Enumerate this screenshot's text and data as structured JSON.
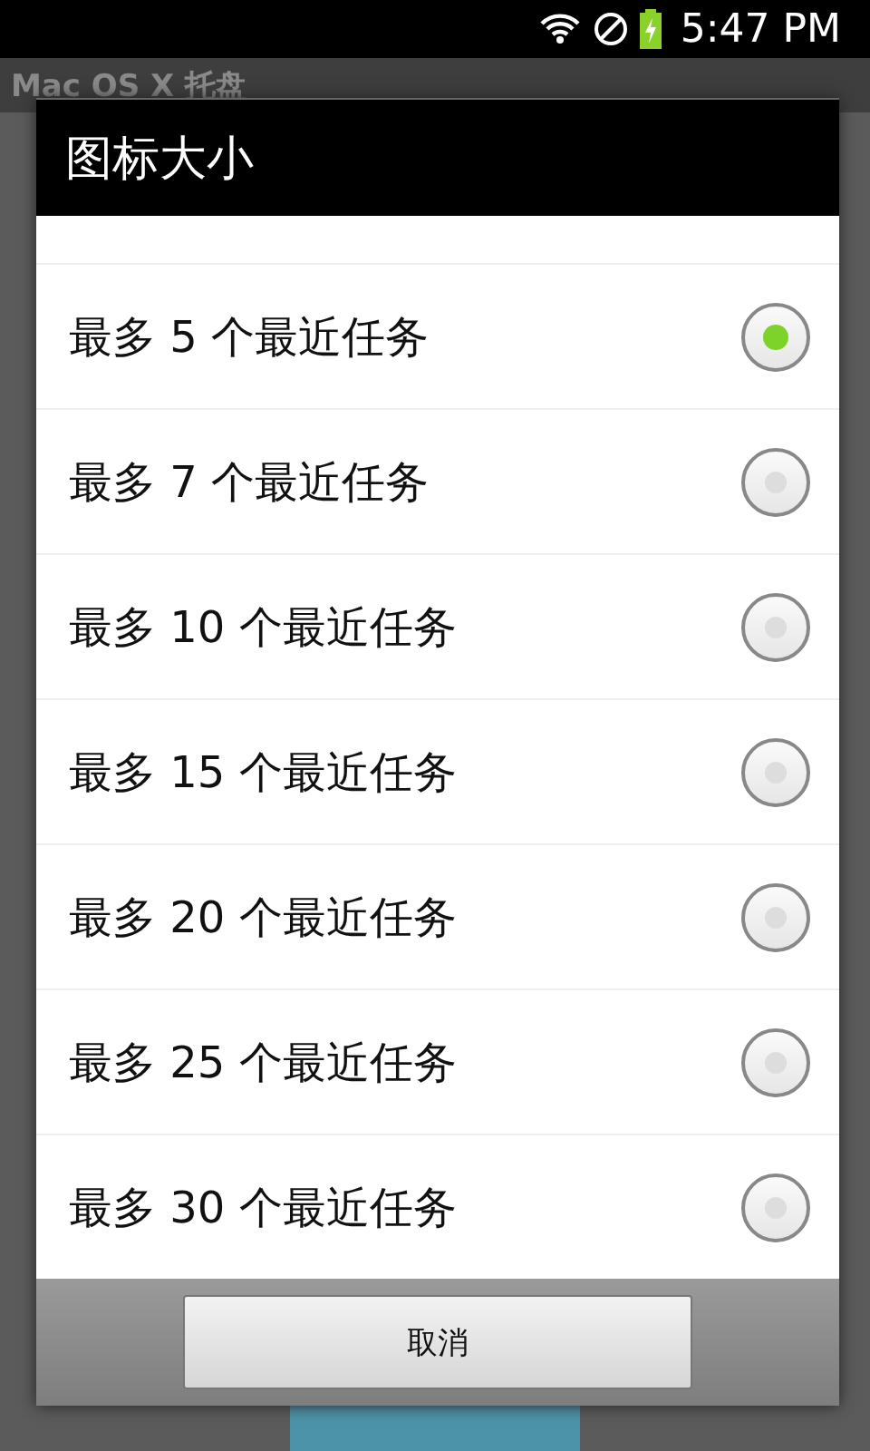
{
  "status_bar": {
    "time": "5:47 PM"
  },
  "app_bar": {
    "title": "Mac OS X 托盘"
  },
  "dialog": {
    "title": "图标大小",
    "options": [
      {
        "label": "最多 5 个最近任务",
        "selected": true
      },
      {
        "label": "最多 7 个最近任务",
        "selected": false
      },
      {
        "label": "最多 10 个最近任务",
        "selected": false
      },
      {
        "label": "最多 15 个最近任务",
        "selected": false
      },
      {
        "label": "最多 20 个最近任务",
        "selected": false
      },
      {
        "label": "最多 25 个最近任务",
        "selected": false
      },
      {
        "label": "最多 30 个最近任务",
        "selected": false
      }
    ],
    "cancel_button": "取消"
  }
}
